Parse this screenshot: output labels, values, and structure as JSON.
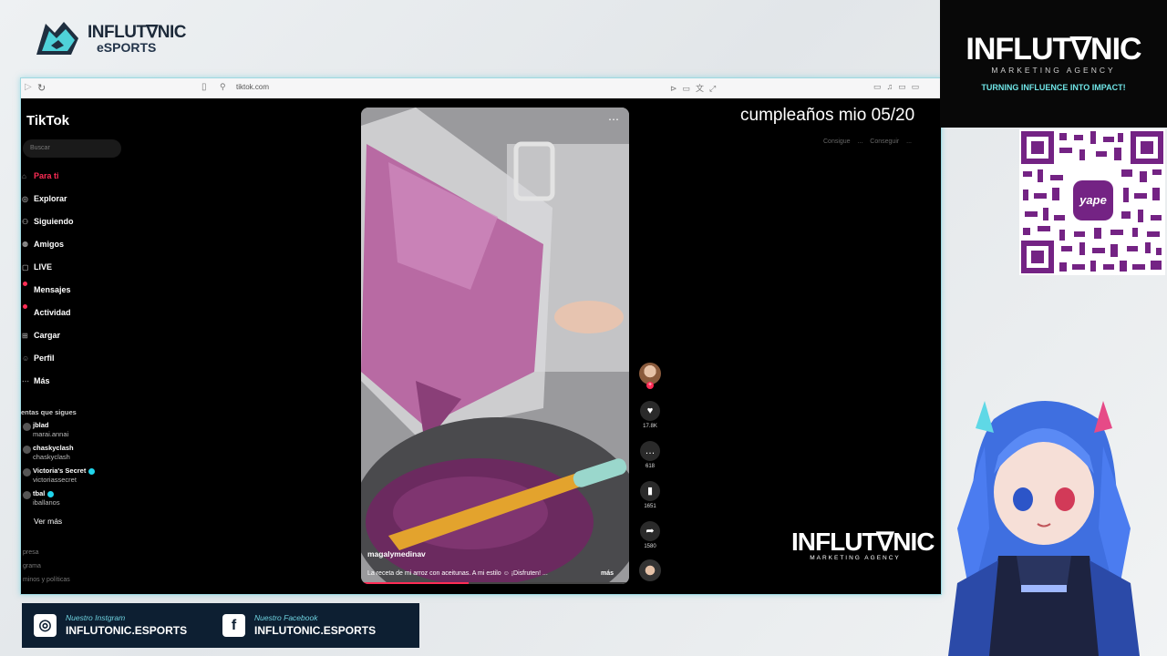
{
  "esports_logo": {
    "line1": "INFLUT∇NIC",
    "line2": "eSPORTS"
  },
  "browser": {
    "url": "tiktok.com"
  },
  "tiktok": {
    "logo": "TikTok",
    "search_placeholder": "Buscar",
    "nav": [
      {
        "label": "Para ti",
        "active": true
      },
      {
        "label": "Explorar"
      },
      {
        "label": "Siguiendo"
      },
      {
        "label": "Amigos"
      },
      {
        "label": "LIVE"
      },
      {
        "label": "Mensajes",
        "badge": true
      },
      {
        "label": "Actividad",
        "badge": true
      },
      {
        "label": "Cargar"
      },
      {
        "label": "Perfil"
      },
      {
        "label": "Más"
      }
    ],
    "following_title": "entas que sigues",
    "accounts": [
      {
        "name": "jblad",
        "handle": "marai.annai"
      },
      {
        "name": "chaskyclash",
        "handle": "chaskyclash"
      },
      {
        "name": "Victoria's Secret",
        "handle": "victoriassecret",
        "verified": true
      },
      {
        "name": "tbal",
        "handle": "iballanos",
        "verified": true
      }
    ],
    "see_more": "Ver más",
    "footer": [
      "presa",
      "grama",
      "minos y políticas"
    ],
    "video": {
      "creator": "magalymedinav",
      "caption": "La receta de mi arroz con aceitunas. A mi estilo ☺ ¡Disfruten! ...",
      "more": "más",
      "likes": "17.8K",
      "comments": "618",
      "saves": "1651",
      "shares": "1580",
      "progress": 0.4
    },
    "top_buttons": "Consigue ... Conseguir ..."
  },
  "overlay_text": "cumpleaños mio 05/20",
  "inframe_logo": {
    "title": "INFLUT∇NIC",
    "subtitle": "MARKETING AGENCY"
  },
  "agency": {
    "title": "INFLUT∇NIC",
    "subtitle": "MARKETING AGENCY",
    "tagline": "TURNING INFLUENCE INTO IMPACT!"
  },
  "qr": {
    "center_label": "yape"
  },
  "social": {
    "instagram": {
      "label": "Nuestro Instgram",
      "handle": "INFLUTONIC.ESPORTS"
    },
    "facebook": {
      "label": "Nuestro Facebook",
      "handle": "INFLUTONIC.ESPORTS"
    }
  },
  "colors": {
    "accent": "#fe2c55",
    "teal": "#6fe4e6",
    "navy": "#0d1f32"
  }
}
